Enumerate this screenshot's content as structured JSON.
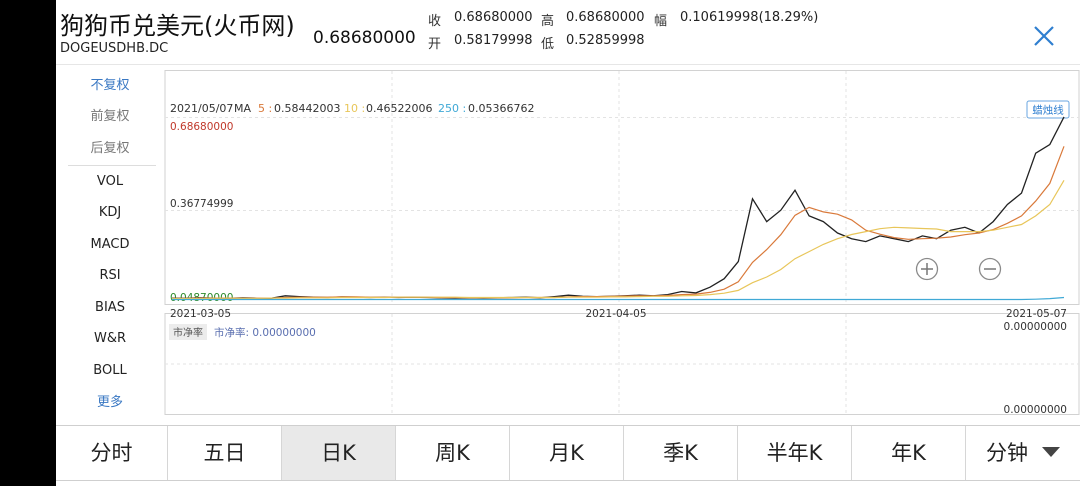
{
  "header": {
    "title": "狗狗币兑美元(火币网)",
    "symbol": "DOGEUSDHB.DC",
    "price": "0.68680000",
    "quote": {
      "close_label": "收",
      "close": "0.68680000",
      "high_label": "高",
      "high": "0.68680000",
      "change_label": "幅",
      "change": "0.10619998(18.29%)",
      "open_label": "开",
      "open": "0.58179998",
      "low_label": "低",
      "low": "0.52859998"
    }
  },
  "sidebar": {
    "items": [
      "不复权",
      "前复权",
      "后复权",
      "VOL",
      "KDJ",
      "MACD",
      "RSI",
      "BIAS",
      "W&R",
      "BOLL",
      "更多"
    ]
  },
  "chart": {
    "date": "2021/05/07",
    "ma_label": "MA",
    "ma5_label": "5 :",
    "ma5": "0.58442003",
    "ma10_label": "10 :",
    "ma10": "0.46522006",
    "ma250_label": "250 :",
    "ma250": "0.05366762",
    "candle_button": "蜡烛线",
    "y_max_label": "0.68680000",
    "y_mid_label": "0.36774999",
    "y_min_label": "0.04870000",
    "x_labels": [
      "2021-03-05",
      "2021-04-05",
      "2021-05-07"
    ],
    "indicator_value_top": "0.00000000",
    "indicator_value_bottom": "0.00000000",
    "indicator_tab": "市净率",
    "indicator_text": "市净率: 0.00000000",
    "colors": {
      "price": "#222222",
      "ma5": "#d9793a",
      "ma10": "#e8c65a",
      "ma250": "#40a9d6",
      "max": "#c0392b",
      "min": "#2e8b2e"
    }
  },
  "chart_data": {
    "type": "line",
    "x": [
      "2021-03-05",
      "2021-03-06",
      "2021-03-07",
      "2021-03-08",
      "2021-03-09",
      "2021-03-10",
      "2021-03-11",
      "2021-03-12",
      "2021-03-13",
      "2021-03-14",
      "2021-03-15",
      "2021-03-16",
      "2021-03-17",
      "2021-03-18",
      "2021-03-19",
      "2021-03-20",
      "2021-03-21",
      "2021-03-22",
      "2021-03-23",
      "2021-03-24",
      "2021-03-25",
      "2021-03-26",
      "2021-03-27",
      "2021-03-28",
      "2021-03-29",
      "2021-03-30",
      "2021-03-31",
      "2021-04-01",
      "2021-04-02",
      "2021-04-03",
      "2021-04-04",
      "2021-04-05",
      "2021-04-06",
      "2021-04-07",
      "2021-04-08",
      "2021-04-09",
      "2021-04-10",
      "2021-04-11",
      "2021-04-12",
      "2021-04-13",
      "2021-04-14",
      "2021-04-15",
      "2021-04-16",
      "2021-04-17",
      "2021-04-18",
      "2021-04-19",
      "2021-04-20",
      "2021-04-21",
      "2021-04-22",
      "2021-04-23",
      "2021-04-24",
      "2021-04-25",
      "2021-04-26",
      "2021-04-27",
      "2021-04-28",
      "2021-04-29",
      "2021-04-30",
      "2021-05-01",
      "2021-05-02",
      "2021-05-03",
      "2021-05-04",
      "2021-05-05",
      "2021-05-06",
      "2021-05-07"
    ],
    "series": [
      {
        "values": [
          0.052,
          0.051,
          0.053,
          0.052,
          0.051,
          0.053,
          0.052,
          0.051,
          0.06,
          0.057,
          0.055,
          0.054,
          0.056,
          0.055,
          0.054,
          0.055,
          0.054,
          0.055,
          0.054,
          0.053,
          0.052,
          0.053,
          0.052,
          0.053,
          0.054,
          0.055,
          0.053,
          0.057,
          0.062,
          0.058,
          0.057,
          0.058,
          0.06,
          0.062,
          0.06,
          0.064,
          0.075,
          0.07,
          0.09,
          0.12,
          0.18,
          0.4,
          0.32,
          0.36,
          0.43,
          0.34,
          0.32,
          0.28,
          0.26,
          0.25,
          0.27,
          0.26,
          0.25,
          0.27,
          0.26,
          0.29,
          0.3,
          0.28,
          0.32,
          0.38,
          0.42,
          0.56,
          0.59,
          0.687
        ]
      },
      {
        "values": [
          0.051,
          0.051,
          0.052,
          0.052,
          0.052,
          0.052,
          0.052,
          0.052,
          0.054,
          0.055,
          0.055,
          0.055,
          0.056,
          0.056,
          0.055,
          0.055,
          0.055,
          0.055,
          0.055,
          0.054,
          0.054,
          0.053,
          0.053,
          0.053,
          0.053,
          0.054,
          0.054,
          0.054,
          0.056,
          0.057,
          0.057,
          0.058,
          0.059,
          0.06,
          0.06,
          0.061,
          0.064,
          0.066,
          0.072,
          0.083,
          0.109,
          0.177,
          0.222,
          0.274,
          0.342,
          0.37,
          0.354,
          0.346,
          0.326,
          0.29,
          0.276,
          0.264,
          0.258,
          0.26,
          0.262,
          0.266,
          0.274,
          0.28,
          0.292,
          0.314,
          0.34,
          0.392,
          0.454,
          0.584
        ]
      },
      {
        "values": [
          0.05,
          0.05,
          0.05,
          0.051,
          0.051,
          0.051,
          0.051,
          0.052,
          0.052,
          0.053,
          0.053,
          0.053,
          0.054,
          0.054,
          0.054,
          0.054,
          0.055,
          0.055,
          0.055,
          0.055,
          0.055,
          0.054,
          0.054,
          0.054,
          0.054,
          0.054,
          0.054,
          0.054,
          0.055,
          0.055,
          0.055,
          0.056,
          0.056,
          0.057,
          0.058,
          0.058,
          0.06,
          0.061,
          0.064,
          0.069,
          0.079,
          0.106,
          0.126,
          0.152,
          0.19,
          0.215,
          0.24,
          0.26,
          0.275,
          0.285,
          0.295,
          0.3,
          0.298,
          0.296,
          0.294,
          0.285,
          0.285,
          0.285,
          0.29,
          0.3,
          0.31,
          0.34,
          0.38,
          0.465
        ]
      },
      {
        "values": [
          0.047,
          0.047,
          0.047,
          0.047,
          0.047,
          0.047,
          0.047,
          0.047,
          0.047,
          0.047,
          0.047,
          0.047,
          0.047,
          0.047,
          0.047,
          0.047,
          0.047,
          0.047,
          0.047,
          0.047,
          0.047,
          0.047,
          0.047,
          0.047,
          0.047,
          0.047,
          0.047,
          0.047,
          0.047,
          0.047,
          0.047,
          0.047,
          0.047,
          0.047,
          0.047,
          0.047,
          0.047,
          0.047,
          0.047,
          0.047,
          0.047,
          0.047,
          0.047,
          0.047,
          0.047,
          0.047,
          0.047,
          0.047,
          0.047,
          0.047,
          0.047,
          0.047,
          0.047,
          0.047,
          0.047,
          0.047,
          0.047,
          0.047,
          0.047,
          0.047,
          0.047,
          0.048,
          0.05,
          0.054
        ]
      }
    ],
    "ylim": [
      0.0487,
      0.6868
    ]
  },
  "tabs": [
    "分时",
    "五日",
    "日K",
    "周K",
    "月K",
    "季K",
    "半年K",
    "年K",
    "分钟"
  ],
  "active_tab": "日K"
}
